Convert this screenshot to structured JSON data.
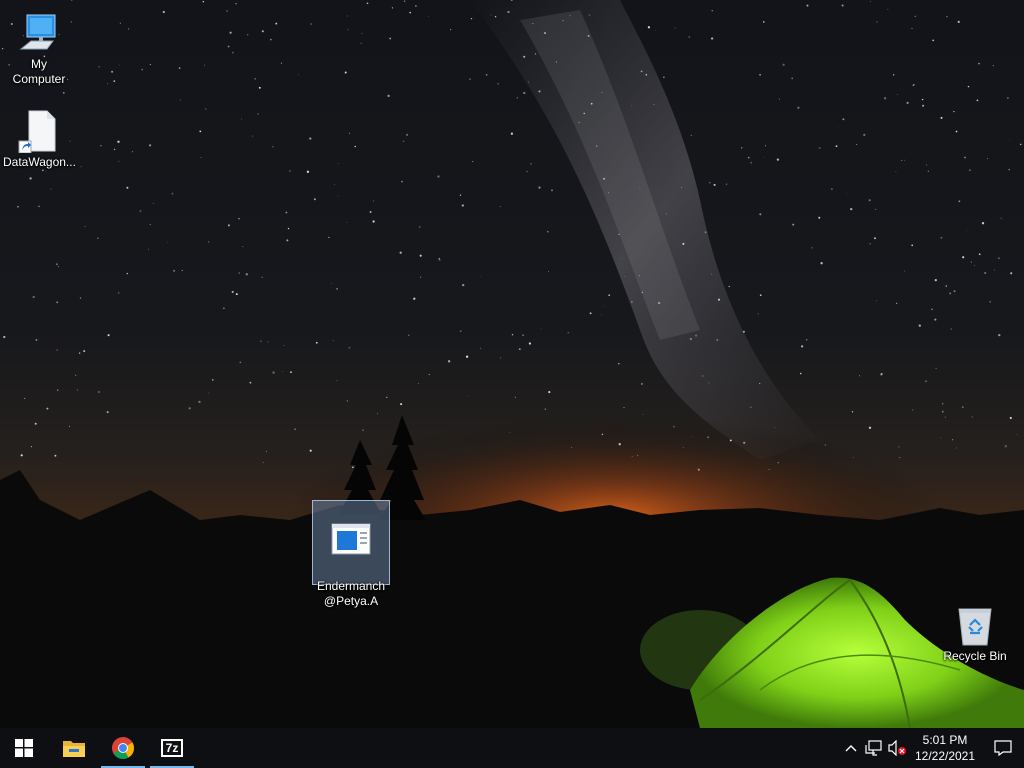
{
  "desktop": {
    "icons": [
      {
        "label": "My Computer",
        "icon": "computer-icon",
        "selected": false
      },
      {
        "label": "DataWagon...",
        "icon": "file-shortcut-icon",
        "selected": false
      },
      {
        "label": "Endermanch\n@Petya.A",
        "icon": "application-window-icon",
        "selected": true
      },
      {
        "label": "Recycle Bin",
        "icon": "recycle-bin-icon",
        "selected": false
      }
    ]
  },
  "taskbar": {
    "start": {
      "icon": "windows-logo-icon"
    },
    "pinned": [
      {
        "name": "File Explorer",
        "icon": "folder-icon",
        "active": false
      },
      {
        "name": "Google Chrome",
        "icon": "chrome-icon",
        "active": true
      },
      {
        "name": "7-Zip",
        "icon": "7zip-icon",
        "text": "7z",
        "active": true
      }
    ],
    "tray": {
      "icons": [
        "chevron-up-icon",
        "network-icon",
        "volume-muted-icon"
      ],
      "time": "5:01 PM",
      "date": "12/22/2021",
      "notification_icon": "notification-icon"
    }
  },
  "colors": {
    "taskbar_bg": "#0e0f12",
    "active_indicator": "#76b9ed",
    "tent_green": "#8ee01f",
    "horizon_glow": "#e0661b"
  }
}
